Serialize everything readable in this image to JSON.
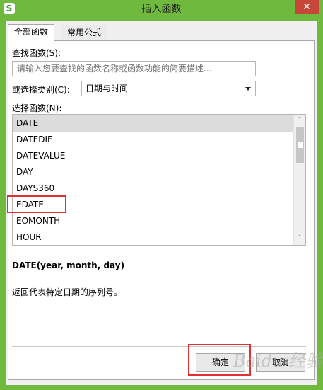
{
  "window": {
    "title": "插入函数",
    "app_icon_glyph": "S",
    "close_glyph": "✕"
  },
  "tabs": [
    {
      "label": "全部函数",
      "active": true
    },
    {
      "label": "常用公式",
      "active": false
    }
  ],
  "search": {
    "label": "查找函数(S):",
    "placeholder": "请输入您要查找的函数名称或函数功能的简要描述..."
  },
  "category": {
    "label": "或选择类别(C):",
    "value": "日期与时间"
  },
  "function_list": {
    "label": "选择函数(N):",
    "items": [
      "DATE",
      "DATEDIF",
      "DATEVALUE",
      "DAY",
      "DAYS360",
      "EDATE",
      "EOMONTH",
      "HOUR"
    ],
    "selected": "DATE"
  },
  "scrollbar": {
    "up_glyph": "˄",
    "down_glyph": "˅"
  },
  "description": {
    "signature": "DATE(year, month, day)",
    "text": "返回代表特定日期的序列号。"
  },
  "buttons": {
    "ok": "确定",
    "cancel": "取消"
  },
  "colors": {
    "title_bar": "#6fb93f",
    "close": "#c7463a",
    "highlight": "#e03030"
  },
  "watermark": "Baidu 经验"
}
